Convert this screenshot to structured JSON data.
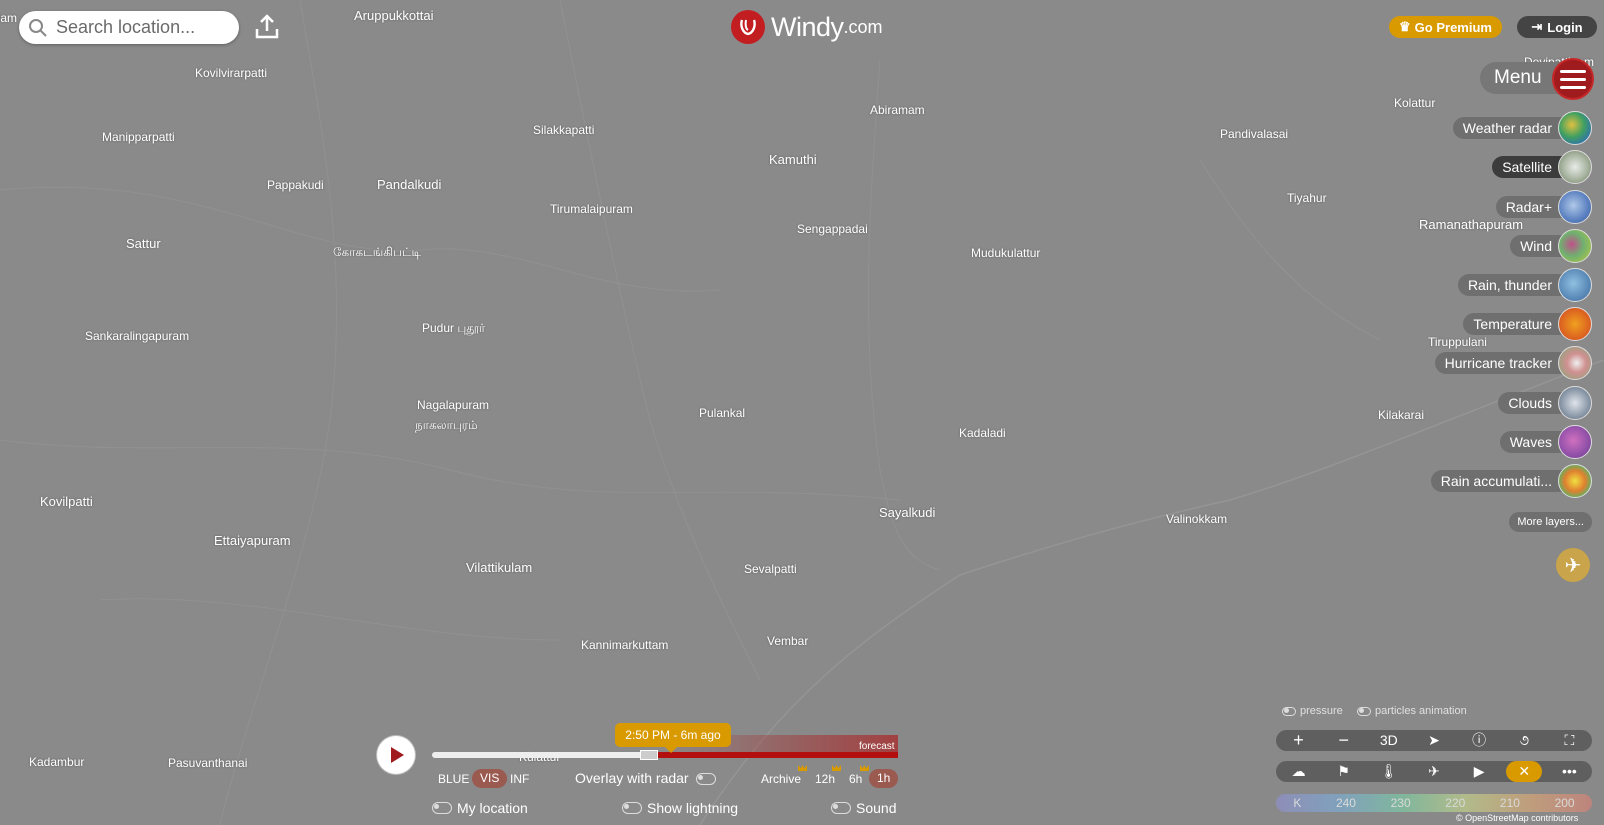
{
  "header": {
    "search_placeholder": "Search location...",
    "logo_text": "Windy",
    "logo_domain": ".com",
    "premium_label": "Go Premium",
    "login_label": "Login",
    "menu_label": "Menu"
  },
  "places": [
    {
      "name": "Aruppukkottai"
    },
    {
      "name": "Kovilvirarpatti"
    },
    {
      "name": "Manipparpatti"
    },
    {
      "name": "Pappakudi"
    },
    {
      "name": "Pandalkudi"
    },
    {
      "name": "Silakkapatti"
    },
    {
      "name": "Tirumalaipuram"
    },
    {
      "name": "Abiramam"
    },
    {
      "name": "Kamuthi"
    },
    {
      "name": "Sengappadai"
    },
    {
      "name": "Mudukulattur"
    },
    {
      "name": "Sattur"
    },
    {
      "name": "கோகடங்கிபட்டி"
    },
    {
      "name": "Sankaralingapuram"
    },
    {
      "name": "Pudur புதூர்"
    },
    {
      "name": "Nagalapuram"
    },
    {
      "name": "நாகலாபுரம்"
    },
    {
      "name": "Pulankal"
    },
    {
      "name": "Kadaladi"
    },
    {
      "name": "Kovilpatti"
    },
    {
      "name": "Ettaiyapuram"
    },
    {
      "name": "Vilattikulam"
    },
    {
      "name": "Sayalkudi"
    },
    {
      "name": "Sevalpatti"
    },
    {
      "name": "Valinokkam"
    },
    {
      "name": "Kannimarkuttam"
    },
    {
      "name": "Vembar"
    },
    {
      "name": "Kadambur"
    },
    {
      "name": "Pasuvanthanai"
    },
    {
      "name": "Kulattur"
    },
    {
      "name": "Kolattur"
    },
    {
      "name": "Pandivalasai"
    },
    {
      "name": "Tiyahur"
    },
    {
      "name": "Ramanathapuram"
    },
    {
      "name": "Tiruppulani"
    },
    {
      "name": "Kilakarai"
    },
    {
      "name": "Devipattinam"
    },
    {
      "name": "llam"
    }
  ],
  "layers": [
    {
      "label": "Weather radar",
      "icon": "weather-radar-icon"
    },
    {
      "label": "Satellite",
      "icon": "satellite-icon",
      "active": true
    },
    {
      "label": "Radar+",
      "icon": "radar-plus-icon"
    },
    {
      "label": "Wind",
      "icon": "wind-icon"
    },
    {
      "label": "Rain, thunder",
      "icon": "rain-thunder-icon"
    },
    {
      "label": "Temperature",
      "icon": "temperature-icon"
    },
    {
      "label": "Hurricane tracker",
      "icon": "hurricane-icon"
    },
    {
      "label": "Clouds",
      "icon": "clouds-icon"
    },
    {
      "label": "Waves",
      "icon": "waves-icon"
    },
    {
      "label": "Rain accumulati...",
      "icon": "rain-accumulation-icon"
    }
  ],
  "more_layers_label": "More layers...",
  "overlay_options": {
    "pressure": "pressure",
    "particles": "particles animation"
  },
  "map_controls": {
    "zoom_in": "+",
    "zoom_out": "−",
    "three_d": "3D"
  },
  "scale": {
    "unit": "K",
    "ticks": [
      "240",
      "230",
      "220",
      "210",
      "200"
    ]
  },
  "attribution": "© OpenStreetMap contributors",
  "timeline": {
    "time_label": "2:50 PM - 6m ago",
    "forecast_label": "forecast",
    "bands": [
      "BLUE",
      "VIS",
      "INF"
    ],
    "active_band": "VIS",
    "overlay_radar_label": "Overlay with radar",
    "archive_label": "Archive",
    "intervals": [
      "12h",
      "6h",
      "1h"
    ],
    "active_interval": "1h",
    "my_location_label": "My location",
    "show_lightning_label": "Show lightning",
    "sound_label": "Sound"
  },
  "colors": {
    "brand_red": "#c21e22",
    "premium_gold": "#d99a00",
    "map_gray": "#8a8a8a"
  }
}
